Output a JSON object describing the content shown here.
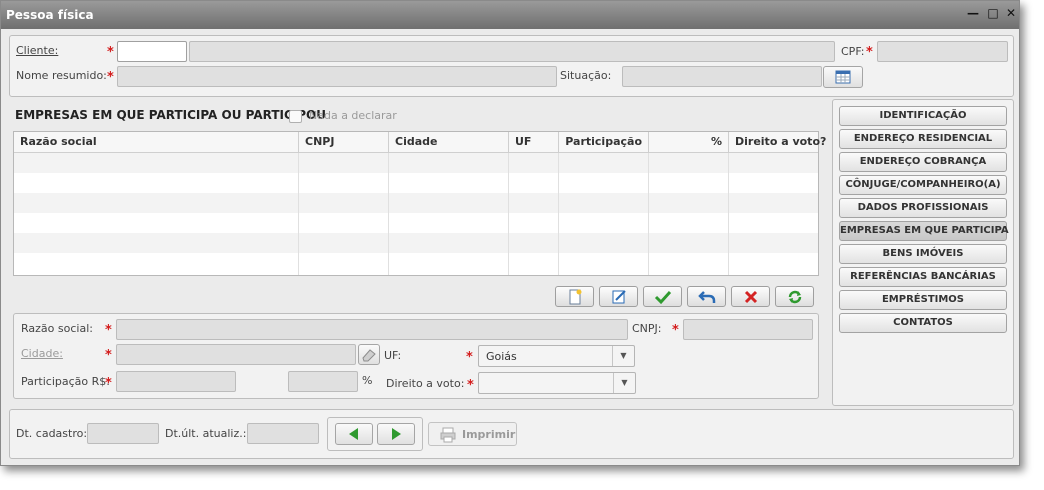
{
  "window": {
    "title": "Pessoa física"
  },
  "client": {
    "cliente_label": "Cliente:",
    "cpf_label": "CPF:",
    "nome_label": "Nome resumido:",
    "situacao_label": "Situação:"
  },
  "section": {
    "title": "EMPRESAS EM QUE PARTICIPA OU PARTICIPOU",
    "nada_label": "Nada a declarar"
  },
  "table": {
    "columns": [
      "Razão social",
      "CNPJ",
      "Cidade",
      "UF",
      "Participação",
      "%",
      "Direito a voto?"
    ]
  },
  "form": {
    "razao_label": "Razão social:",
    "cnpj_label": "CNPJ:",
    "cidade_label": "Cidade:",
    "uf_label": "UF:",
    "uf_value": "Goiás",
    "participacao_label": "Participação R$:",
    "pct_label": "%",
    "voto_label": "Direito a voto:"
  },
  "nav": {
    "items": [
      "IDENTIFICAÇÃO",
      "ENDEREÇO RESIDENCIAL",
      "ENDEREÇO COBRANÇA",
      "CÔNJUGE/COMPANHEIRO(A)",
      "DADOS PROFISSIONAIS",
      "EMPRESAS EM QUE PARTICIPA",
      "BENS IMÓVEIS",
      "REFERÊNCIAS BANCÁRIAS",
      "EMPRÉSTIMOS",
      "CONTATOS"
    ],
    "active": "EMPRESAS EM QUE PARTICIPA"
  },
  "footer": {
    "cadastro_label": "Dt. cadastro:",
    "atualiz_label": "Dt.últ. atualiz.:",
    "imprimir_label": "Imprimir"
  },
  "colors": {
    "required": "#d31b1b",
    "confirm": "#2f9a2f",
    "delete": "#d42323",
    "edit": "#2a6bb5"
  }
}
